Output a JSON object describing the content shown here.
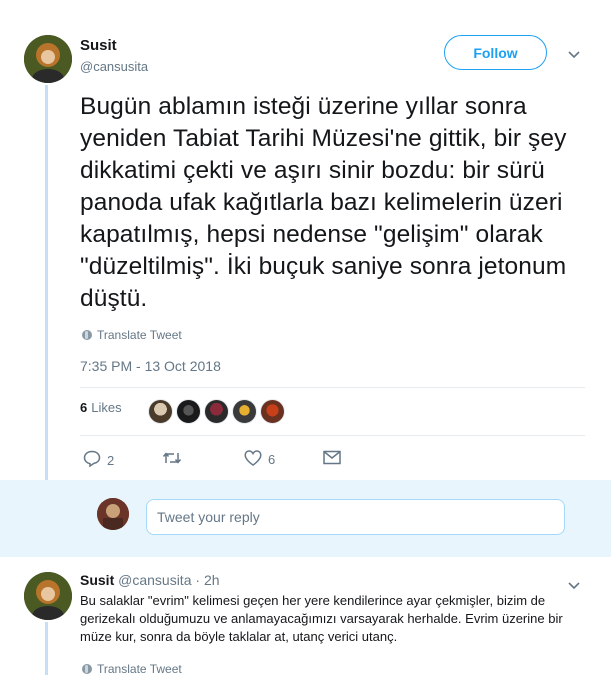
{
  "tweet": {
    "author_name": "Susit",
    "author_handle": "@cansusita",
    "follow_label": "Follow",
    "text": "Bugün ablamın isteği üzerine yıllar sonra yeniden Tabiat Tarihi Müzesi'ne gittik, bir şey dikkatimi çekti ve aşırı sinir bozdu: bir sürü panoda ufak kağıtlarla bazı kelimelerin üzeri kapatılmış, hepsi nedense \"gelişim\" olarak \"düzeltilmiş\". İki buçuk saniye sonra jetonum düştü.",
    "translate_label": "Translate Tweet",
    "timestamp": "7:35 PM - 13 Oct 2018",
    "likes_count": "6",
    "likes_label": "Likes",
    "reply_count": "2",
    "retweet_count": "",
    "like_count": "6"
  },
  "reply_box": {
    "placeholder": "Tweet your reply"
  },
  "reply": {
    "author_name": "Susit",
    "author_handle": "@cansusita",
    "separator": "·",
    "time": "2h",
    "text": "Bu salaklar \"evrim\" kelimesi geçen her yere kendilerince ayar çekmişler, bizim de gerizekalı olduğumuzu ve anlamayacağımızı varsayarak herhalde. Evrim üzerine bir müze kur, sonra da böyle taklalar at, utanç verici utanç.",
    "translate_label": "Translate Tweet"
  },
  "colors": {
    "accent": "#1da1f2",
    "muted": "#657786",
    "thread_line": "#c4dff6",
    "reply_bg": "#e8f5fd"
  },
  "icons": [
    "chevron-down-icon",
    "globe-icon",
    "reply-icon",
    "retweet-icon",
    "heart-icon",
    "direct-message-icon"
  ]
}
